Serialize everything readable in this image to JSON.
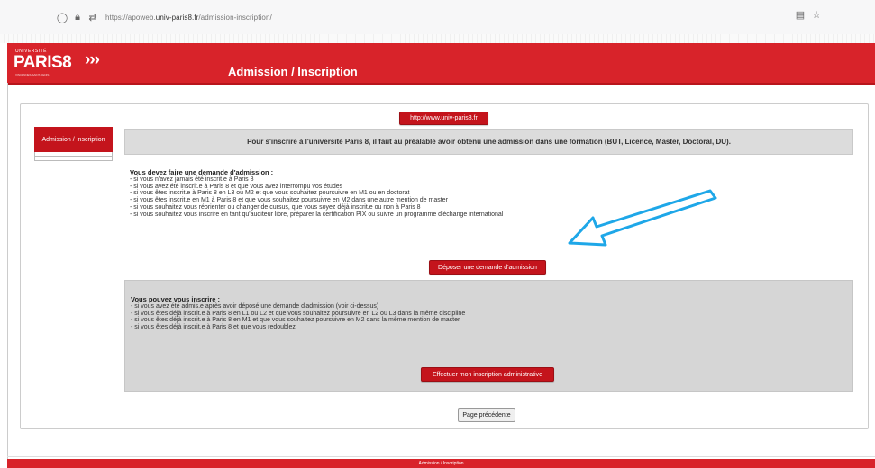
{
  "browser": {
    "url_prefix": "https://apoweb.",
    "url_domain": "univ-paris8.fr",
    "url_path": "/admission-inscription/",
    "icons": [
      "shield-icon",
      "lock-icon",
      "permissions-icon",
      "reader-mode-icon",
      "bookmark-star-icon"
    ]
  },
  "header": {
    "logo_universite": "UNIVERSITÉ",
    "logo_paris8": "PARIS8",
    "logo_tagline": "VINCENNES-SAINT-DENIS",
    "chevrons": "›››",
    "title": "Admission / Inscription"
  },
  "top_link": "http://www.univ-paris8.fr",
  "side_menu": {
    "active_item": "Admission / Inscription"
  },
  "banner": "Pour s'inscrire à l'université Paris 8, il faut au préalable avoir obtenu une admission dans une formation (BUT, Licence, Master, Doctoral, DU).",
  "admission_section": {
    "heading": "Vous devez faire une demande d'admission :",
    "items": [
      "- si vous n'avez jamais été inscrit.e à Paris 8",
      "- si vous avez été inscrit.e à Paris 8 et que vous avez interrompu vos études",
      "- si vous êtes inscrit.e à Paris 8 en L3 ou M2 et que vous souhaitez poursuivre en M1 ou en doctorat",
      "- si vous êtes inscrit.e en M1 à Paris 8 et que vous souhaitez poursuivre en M2 dans une autre mention de master",
      "- si vous souhaitez vous réorienter ou changer de cursus, que vous soyez déjà inscrit.e ou non à Paris 8",
      "- si vous souhaitez vous inscrire en tant qu'auditeur libre, préparer la certification PIX ou suivre un programme d'échange international"
    ],
    "button": "Déposer une demande d'admission"
  },
  "inscription_section": {
    "heading": "Vous pouvez vous inscrire :",
    "items": [
      "- si vous avez été admis.e après avoir déposé une demande d'admission (voir ci-dessus)",
      "- si vous êtes déjà inscrit.e à Paris 8 en L1 ou L2 et que vous souhaitez poursuivre en L2 ou L3 dans la même discipline",
      "- si vous êtes déjà inscrit.e à Paris 8 en M1 et que vous souhaitez poursuivre en M2 dans la même mention de master",
      "- si vous êtes déjà inscrit.e à Paris 8 et que vous redoublez"
    ],
    "button": "Effectuer mon inscription administrative"
  },
  "back_button": "Page précédente",
  "footer": "Admission / Inscription",
  "colors": {
    "brand_red": "#d8232a",
    "button_red": "#c4141c",
    "arrow_blue": "#1ea7e8"
  }
}
